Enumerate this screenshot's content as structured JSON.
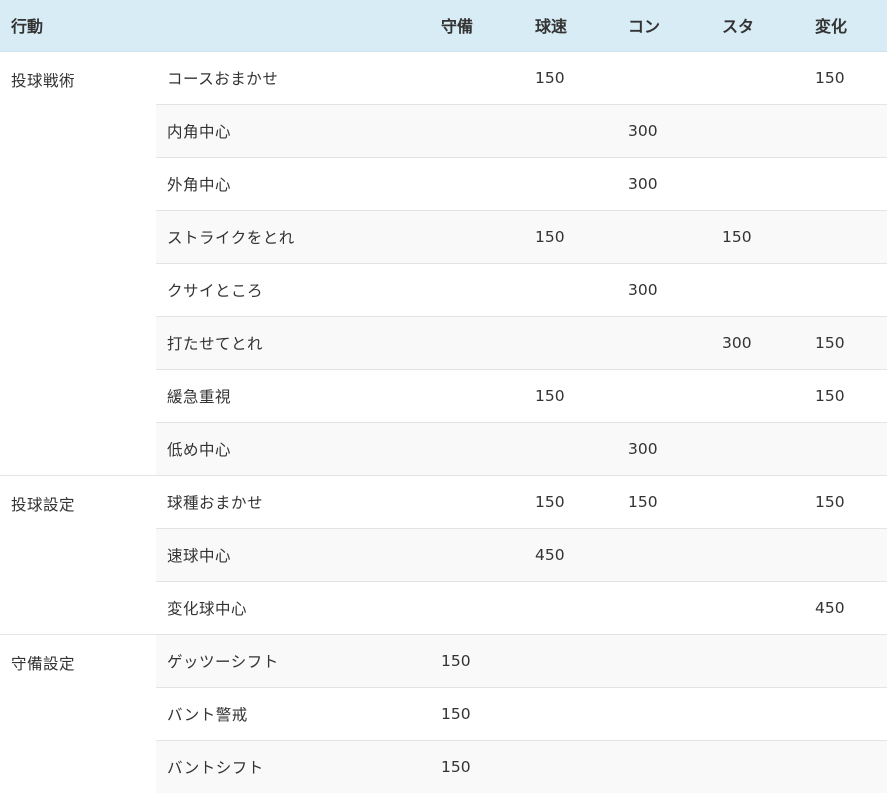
{
  "table": {
    "headers": [
      "行動",
      "",
      "守備",
      "球速",
      "コン",
      "スタ",
      "変化"
    ],
    "groups": [
      {
        "category": "投球戦術",
        "rows": [
          {
            "action": "コースおまかせ",
            "values": [
              "",
              "150",
              "",
              "",
              "150"
            ]
          },
          {
            "action": "内角中心",
            "values": [
              "",
              "",
              "300",
              "",
              ""
            ]
          },
          {
            "action": "外角中心",
            "values": [
              "",
              "",
              "300",
              "",
              ""
            ]
          },
          {
            "action": "ストライクをとれ",
            "values": [
              "",
              "150",
              "",
              "150",
              ""
            ]
          },
          {
            "action": "クサイところ",
            "values": [
              "",
              "",
              "300",
              "",
              ""
            ]
          },
          {
            "action": "打たせてとれ",
            "values": [
              "",
              "",
              "",
              "300",
              "150"
            ]
          },
          {
            "action": "緩急重視",
            "values": [
              "",
              "150",
              "",
              "",
              "150"
            ]
          },
          {
            "action": "低め中心",
            "values": [
              "",
              "",
              "300",
              "",
              ""
            ]
          }
        ]
      },
      {
        "category": "投球設定",
        "rows": [
          {
            "action": "球種おまかせ",
            "values": [
              "",
              "150",
              "150",
              "",
              "150"
            ]
          },
          {
            "action": "速球中心",
            "values": [
              "",
              "450",
              "",
              "",
              ""
            ]
          },
          {
            "action": "変化球中心",
            "values": [
              "",
              "",
              "",
              "",
              "450"
            ]
          }
        ]
      },
      {
        "category": "守備設定",
        "rows": [
          {
            "action": "ゲッツーシフト",
            "values": [
              "150",
              "",
              "",
              "",
              ""
            ]
          },
          {
            "action": "バント警戒",
            "values": [
              "150",
              "",
              "",
              "",
              ""
            ]
          },
          {
            "action": "バントシフト",
            "values": [
              "150",
              "",
              "",
              "",
              ""
            ]
          }
        ]
      }
    ]
  }
}
